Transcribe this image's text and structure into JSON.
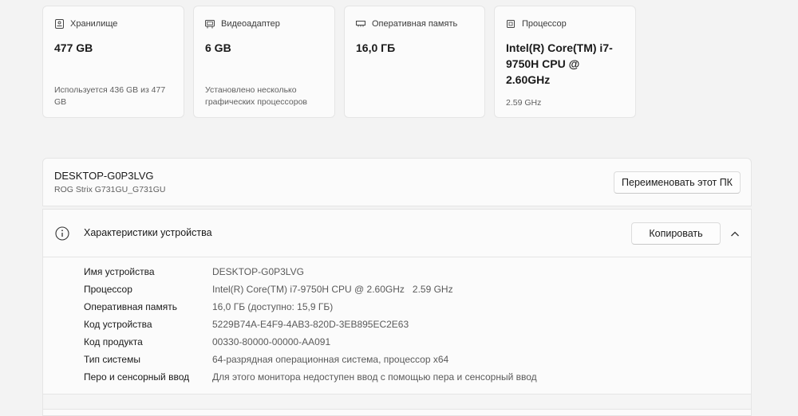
{
  "cards": [
    {
      "label": "Хранилище",
      "icon": "storage-icon",
      "value": "477 GB",
      "sub": "Используется 436 GB из 477 GB"
    },
    {
      "label": "Видеоадаптер",
      "icon": "gpu-icon",
      "value": "6 GB",
      "sub": "Установлено несколько графических процессоров"
    },
    {
      "label": "Оперативная память",
      "icon": "ram-icon",
      "value": "16,0 ГБ",
      "sub": ""
    },
    {
      "label": "Процессор",
      "icon": "cpu-icon",
      "value": "Intel(R) Core(TM) i7-9750H CPU @ 2.60GHz",
      "sub": "2.59 GHz"
    }
  ],
  "device": {
    "name": "DESKTOP-G0P3LVG",
    "model": "ROG Strix G731GU_G731GU",
    "rename_button": "Переименовать этот ПК"
  },
  "specs": {
    "title": "Характеристики устройства",
    "copy_button": "Копировать",
    "rows": [
      {
        "key": "Имя устройства",
        "value": "DESKTOP-G0P3LVG"
      },
      {
        "key": "Процессор",
        "value": "Intel(R) Core(TM) i7-9750H CPU @ 2.60GHz   2.59 GHz"
      },
      {
        "key": "Оперативная память",
        "value": "16,0 ГБ (доступно: 15,9 ГБ)"
      },
      {
        "key": "Код устройства",
        "value": "5229B74A-E4F9-4AB3-820D-3EB895EC2E63"
      },
      {
        "key": "Код продукта",
        "value": "00330-80000-00000-AA091"
      },
      {
        "key": "Тип системы",
        "value": "64-разрядная операционная система, процессор x64"
      },
      {
        "key": "Перо и сенсорный ввод",
        "value": "Для этого монитора недоступен ввод с помощью пера и сенсорный ввод"
      }
    ]
  }
}
